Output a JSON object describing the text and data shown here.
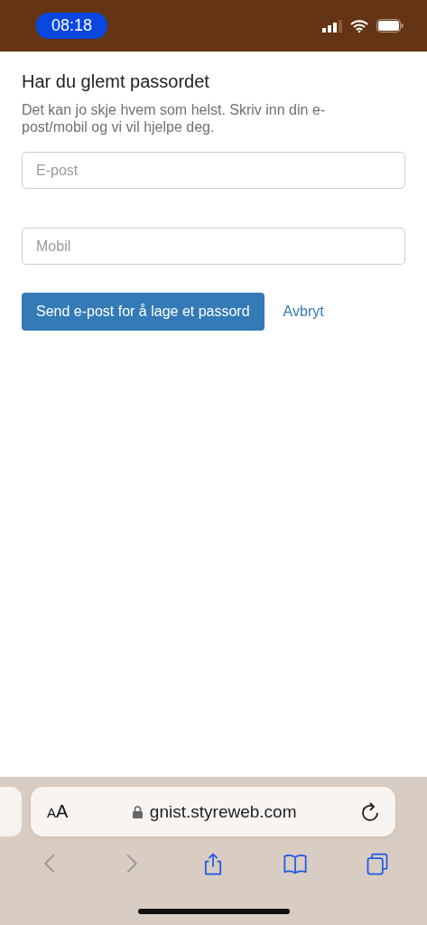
{
  "status_bar": {
    "time": "08:18"
  },
  "form": {
    "title": "Har du glemt passordet",
    "description": "Det kan jo skje hvem som helst. Skriv inn din e-post/mobil og vi vil hjelpe deg.",
    "fields": [
      {
        "placeholder": "E-post"
      },
      {
        "placeholder": "Mobil"
      }
    ],
    "submit": "Send e-post for å lage et passord",
    "cancel": "Avbryt"
  },
  "browser": {
    "text_size": "AA",
    "url": "gnist.styreweb.com",
    "toolbar": [
      {
        "kind": "back",
        "disabled": true
      },
      {
        "kind": "forward",
        "disabled": true
      },
      {
        "kind": "share",
        "disabled": false
      },
      {
        "kind": "bookmarks",
        "disabled": false
      },
      {
        "kind": "tabs",
        "disabled": false
      }
    ]
  }
}
